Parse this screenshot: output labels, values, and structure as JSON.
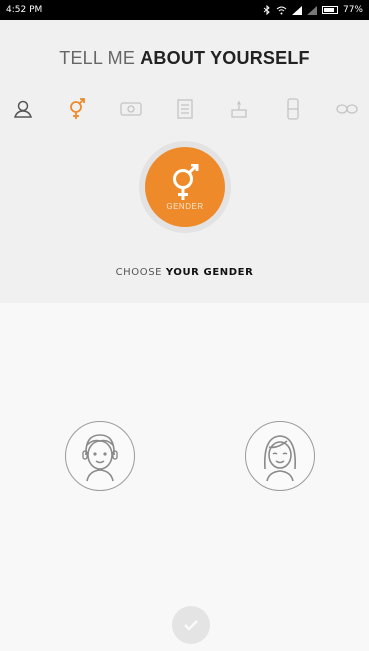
{
  "status_bar": {
    "time": "4:52 PM",
    "battery": "77%"
  },
  "header": {
    "title_light": "TELL ME",
    "title_bold": "ABOUT YOURSELF"
  },
  "steps": [
    {
      "name": "profile-icon",
      "active": false
    },
    {
      "name": "gender-icon",
      "active": true
    },
    {
      "name": "id-card-icon",
      "active": false
    },
    {
      "name": "document-icon",
      "active": false
    },
    {
      "name": "cake-icon",
      "active": false
    },
    {
      "name": "body-icon",
      "active": false
    },
    {
      "name": "glasses-icon",
      "active": false
    }
  ],
  "current_step": {
    "label": "GENDER"
  },
  "prompt": {
    "light": "CHOOSE",
    "bold": "YOUR GENDER"
  },
  "options": [
    {
      "name": "male",
      "icon": "male-avatar-icon"
    },
    {
      "name": "female",
      "icon": "female-avatar-icon"
    }
  ],
  "colors": {
    "accent": "#ee8a2a",
    "inactive": "#bdbdbd"
  }
}
